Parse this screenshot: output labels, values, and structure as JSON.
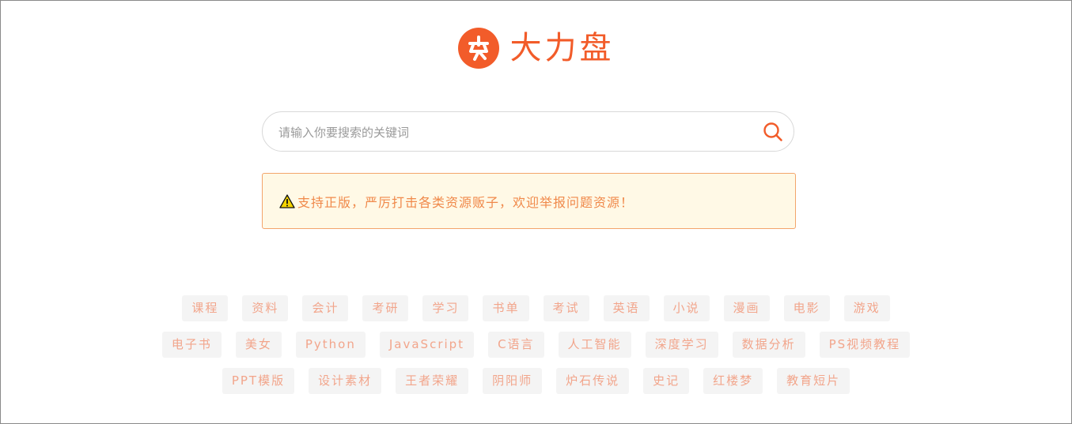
{
  "brand": {
    "name": "大力盘",
    "color": "#f25c2a"
  },
  "search": {
    "placeholder": "请输入你要搜索的关键词",
    "value": ""
  },
  "notice": {
    "text": "支持正版，严厉打击各类资源贩子，欢迎举报问题资源！"
  },
  "tags": {
    "row1": [
      "课程",
      "资料",
      "会计",
      "考研",
      "学习",
      "书单",
      "考试",
      "英语",
      "小说",
      "漫画",
      "电影",
      "游戏"
    ],
    "row2": [
      "电子书",
      "美女",
      "Python",
      "JavaScript",
      "C语言",
      "人工智能",
      "深度学习",
      "数据分析",
      "PS视频教程"
    ],
    "row3": [
      "PPT模版",
      "设计素材",
      "王者荣耀",
      "阴阳师",
      "炉石传说",
      "史记",
      "红楼梦",
      "教育短片"
    ]
  },
  "colors": {
    "accent": "#f25c2a",
    "tag_text": "#f2a58b",
    "tag_bg": "#f4f4f4",
    "notice_bg": "#fff9e6",
    "notice_border": "#f3a56b",
    "notice_text": "#f0894a"
  }
}
